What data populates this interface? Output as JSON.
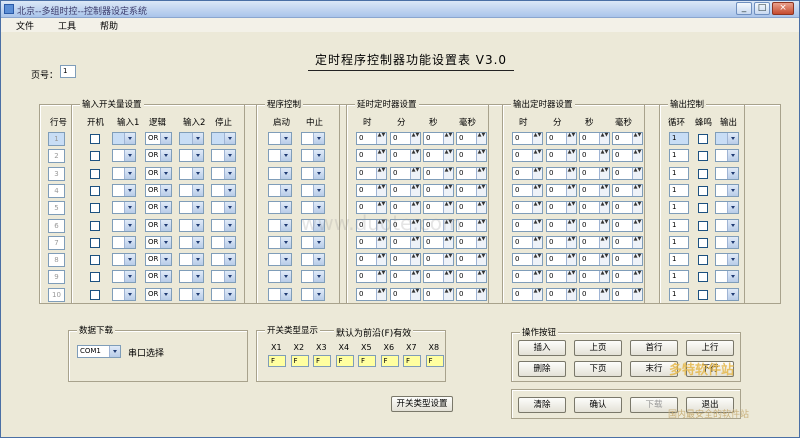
{
  "window": {
    "title": "北京--多组时控--控制器设定系统",
    "min": "_",
    "max": "□",
    "close": "×"
  },
  "menu": [
    "文件",
    "工具",
    "帮助"
  ],
  "page_no": {
    "label": "页号：",
    "value": "1"
  },
  "form_title": "定时程序控制器功能设置表 V3.0",
  "row_header": "行号",
  "row_numbers": [
    "1",
    "2",
    "3",
    "4",
    "5",
    "6",
    "7",
    "8",
    "9",
    "10"
  ],
  "groups": {
    "input": {
      "title": "输入开关量设置",
      "headers": [
        "开机",
        "输入1",
        "逻辑",
        "输入2",
        "停止"
      ],
      "logic_value": "OR"
    },
    "program": {
      "title": "程序控制",
      "headers": [
        "启动",
        "中止"
      ]
    },
    "delay": {
      "title": "延时定时器设置",
      "headers": [
        "时",
        "分",
        "秒",
        "毫秒"
      ]
    },
    "output_timer": {
      "title": "输出定时器设置",
      "headers": [
        "时",
        "分",
        "秒",
        "毫秒"
      ]
    },
    "output_ctrl": {
      "title": "输出控制",
      "headers": [
        "循环",
        "蜂鸣",
        "输出"
      ]
    }
  },
  "spin_value": "0",
  "cycle_value": "1",
  "data_download": {
    "title": "数据下载",
    "port": "COM1",
    "port_label": "串口选择"
  },
  "switch_type": {
    "title": "开关类型显示",
    "note": "默认为前沿(F)有效",
    "labels": [
      "X1",
      "X2",
      "X3",
      "X4",
      "X5",
      "X6",
      "X7",
      "X8"
    ],
    "values": [
      "F",
      "F",
      "F",
      "F",
      "F",
      "F",
      "F",
      "F"
    ],
    "button": "开关类型设置"
  },
  "operations": {
    "title": "操作按钮",
    "buttons": [
      "插入",
      "上页",
      "首行",
      "上行",
      "删除",
      "下页",
      "末行",
      "下行"
    ],
    "bottom": [
      "清除",
      "确认",
      "下载",
      "退出"
    ]
  },
  "watermark": {
    "line1": "多特软件站",
    "line2": "国内最安全的软件站",
    "center": "www.duote.com"
  }
}
